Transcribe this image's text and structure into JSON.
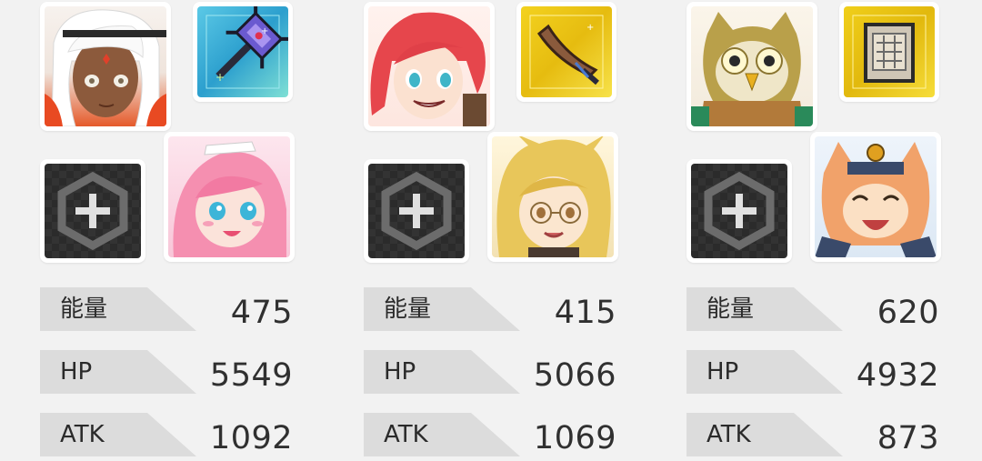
{
  "teams": [
    {
      "hero_icon": "tan-white-haired-girl-portrait",
      "weapon_icon": "crystal-spiked-mace-icon",
      "support_icon": "pink-haired-maid-portrait",
      "add_icon": "plus-hex-icon",
      "stats": [
        {
          "label": "能量",
          "value": "475"
        },
        {
          "label": "HP",
          "value": "5549"
        },
        {
          "label": "ATK",
          "value": "1092"
        }
      ]
    },
    {
      "hero_icon": "red-haired-girl-portrait",
      "weapon_icon": "curved-blade-icon",
      "support_icon": "blonde-fox-girl-glasses-portrait",
      "add_icon": "plus-hex-icon",
      "stats": [
        {
          "label": "能量",
          "value": "415"
        },
        {
          "label": "HP",
          "value": "5066"
        },
        {
          "label": "ATK",
          "value": "1069"
        }
      ]
    },
    {
      "hero_icon": "owl-knight-portrait",
      "weapon_icon": "grid-tome-icon",
      "support_icon": "laughing-cat-portrait",
      "add_icon": "plus-hex-icon",
      "stats": [
        {
          "label": "能量",
          "value": "620"
        },
        {
          "label": "HP",
          "value": "4932"
        },
        {
          "label": "ATK",
          "value": "873"
        }
      ]
    }
  ]
}
